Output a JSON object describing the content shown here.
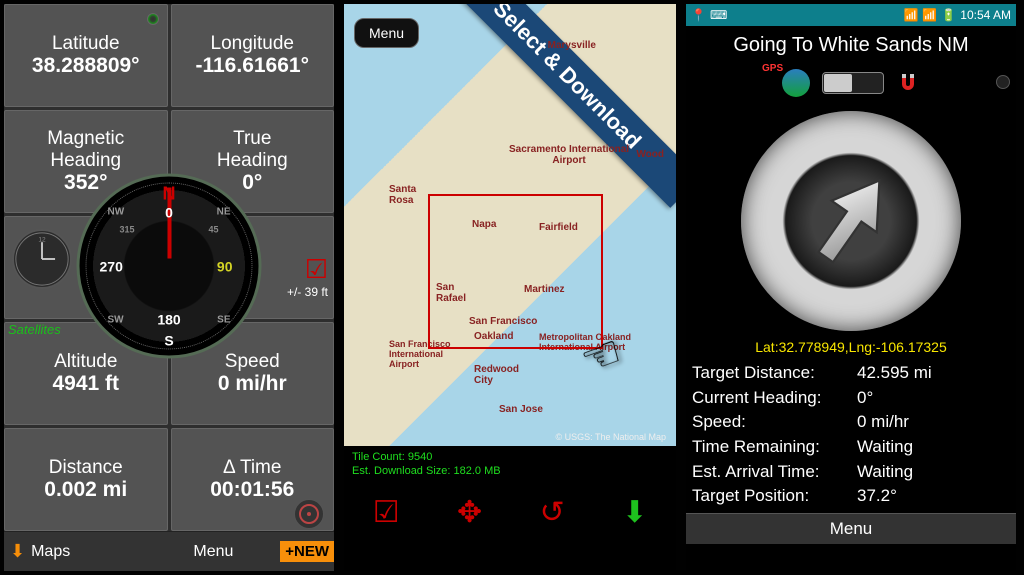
{
  "phone1": {
    "latitude_label": "Latitude",
    "latitude_value": "38.288809°",
    "longitude_label": "Longitude",
    "longitude_value": "-116.61661°",
    "mag_heading_label": "Magnetic\nHeading",
    "mag_heading_value": "352°",
    "true_heading_label": "True\nHeading",
    "true_heading_value": "0°",
    "altitude_label": "Altitude",
    "altitude_value": "4941 ft",
    "speed_label": "Speed",
    "speed_value": "0 mi/hr",
    "distance_label": "Distance",
    "distance_value": "0.002 mi",
    "dtime_label": "Δ Time",
    "dtime_value": "00:01:56",
    "satellites": "Satellites",
    "accuracy": "+/- 39 ft",
    "compass": {
      "n": "N",
      "s": "S",
      "e": "90",
      "w": "270",
      "zero": "0",
      "s180": "180",
      "nw": "NW",
      "ne": "NE",
      "sw": "SW",
      "se": "SE",
      "d315": "315",
      "d45": "45"
    },
    "maps_btn": "Maps",
    "menu_btn": "Menu",
    "new_btn": "+NEW"
  },
  "phone2": {
    "menu_btn": "Menu",
    "ribbon": "Select & Download",
    "tile_count": "Tile Count: 9540",
    "dl_size": "Est. Download Size: 182.0 MB",
    "attribution": "© USGS: The National Map",
    "cities": {
      "marysville": "Marysville",
      "woodland": "Wood",
      "sacramento": "Sacramento International\nAirport",
      "santarosa": "Santa\nRosa",
      "napa": "Napa",
      "fairfield": "Fairfield",
      "sanrafael": "San\nRafael",
      "martinez": "Martinez",
      "sanfrancisco": "San Francisco",
      "oakland": "Oakland",
      "sfair": "San Francisco\nInternational\nAirport",
      "oakair": "Metropolitan Oakland\nInternational Airport",
      "redwood": "Redwood\nCity",
      "sanjose": "San Jose"
    }
  },
  "phone3": {
    "time": "10:54 AM",
    "title": "Going To White Sands NM",
    "gps": "GPS",
    "latlng": "Lat:32.778949,Lng:-106.17325",
    "rows": [
      {
        "k": "Target Distance:",
        "v": "42.595 mi"
      },
      {
        "k": "Current Heading:",
        "v": "0°"
      },
      {
        "k": "Speed:",
        "v": "0 mi/hr"
      },
      {
        "k": "Time Remaining:",
        "v": "Waiting"
      },
      {
        "k": "Est. Arrival Time:",
        "v": "Waiting"
      },
      {
        "k": "Target Position:",
        "v": "37.2°"
      }
    ],
    "menu": "Menu"
  }
}
